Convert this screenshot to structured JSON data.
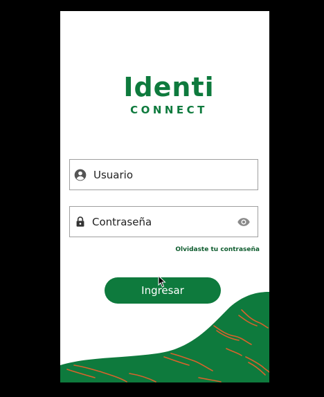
{
  "brand": {
    "name": "Identi",
    "tagline": "CONNECT"
  },
  "login": {
    "username_placeholder": "Usuario",
    "password_placeholder": "Contraseña",
    "forgot_password": "Olvidaste tu contraseña",
    "submit_label": "Ingresar"
  },
  "icons": {
    "user": "account-circle-icon",
    "lock": "lock-icon",
    "visibility": "eye-icon"
  },
  "colors": {
    "brand_green": "#0e7a3d",
    "accent_orange": "#d9622b",
    "background": "#ffffff"
  }
}
